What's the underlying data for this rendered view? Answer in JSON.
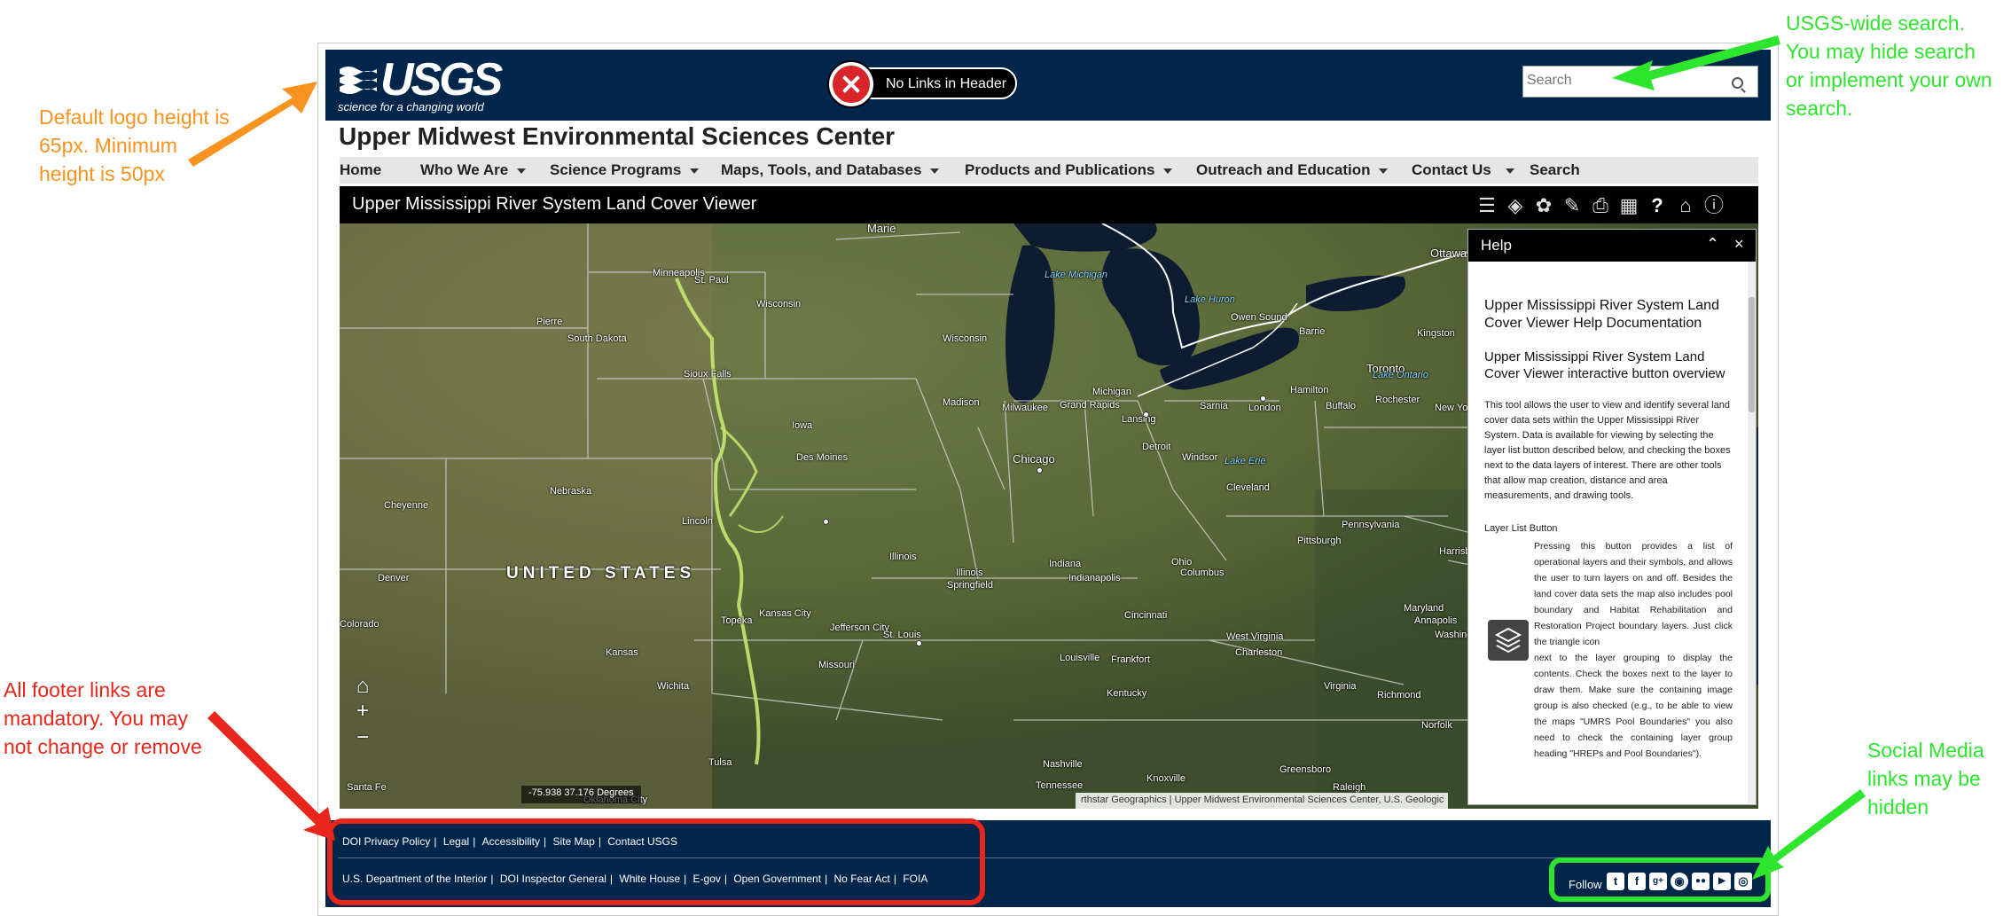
{
  "annotations": {
    "logo_note": [
      "Default logo height is",
      "65px. Minimum",
      "height is 50px"
    ],
    "search_note": [
      "USGS-wide search.",
      "You may hide search",
      "or implement your own",
      "search."
    ],
    "footer_note": [
      "All footer links are",
      "mandatory. You may",
      "not change or remove"
    ],
    "social_note": [
      "Social Media",
      "links may be",
      "hidden"
    ]
  },
  "header": {
    "logo_word": "USGS",
    "logo_tagline": "science for a changing world",
    "no_links_label": "No Links in Header",
    "search_placeholder": "Search"
  },
  "site_title": "Upper Midwest Environmental Sciences Center",
  "nav": [
    {
      "label": "Home",
      "dropdown": false
    },
    {
      "label": "Who We Are",
      "dropdown": true
    },
    {
      "label": "Science Programs",
      "dropdown": true
    },
    {
      "label": "Maps, Tools, and Databases",
      "dropdown": true
    },
    {
      "label": "Products and Publications",
      "dropdown": true
    },
    {
      "label": "Outreach and Education",
      "dropdown": true
    },
    {
      "label": "Contact Us",
      "dropdown": true
    },
    {
      "label": "Search",
      "dropdown": false
    }
  ],
  "app": {
    "title": "Upper Mississippi River System Land Cover Viewer",
    "tools": [
      "layer-list-icon",
      "layers-icon",
      "palette-icon",
      "ruler-icon",
      "print-icon",
      "basemap-grid-icon",
      "help-icon",
      "education-icon",
      "info-icon"
    ]
  },
  "map": {
    "coords": "-75.938 37.176 Degrees",
    "attribution": "rthstar Geographics | Upper Midwest Environmental Sciences Center, U.S. Geologic",
    "country_label": "UNITED STATES",
    "lakes": [
      "Lake Michigan",
      "Lake Huron",
      "Lake Ontario",
      "Lake Erie"
    ],
    "places": [
      "Marie",
      "Ottawa",
      "Minneapolis",
      "St. Paul",
      "Wisconsin",
      "Pierre",
      "South Dakota",
      "Wisconsin",
      "Owen Sound",
      "Barrie",
      "Kingston",
      "Toronto",
      "Sioux Falls",
      "Madison",
      "Milwaukee",
      "Michigan",
      "Grand Rapids",
      "Lansing",
      "Sarnia",
      "London",
      "Hamilton",
      "Buffalo",
      "Rochester",
      "New Yo",
      "Iowa",
      "Des Moines",
      "Chicago",
      "Detroit",
      "Windsor",
      "Cleveland",
      "Nebraska",
      "Cheyenne",
      "Lincoln",
      "Illinois",
      "Illinois",
      "Springfield",
      "Indiana",
      "Indianapolis",
      "Ohio",
      "Columbus",
      "Pittsburgh",
      "Pennsylvania",
      "Harrisburg",
      "Denver",
      "Topeka",
      "Kansas City",
      "Jefferson City",
      "St. Louis",
      "Cincinnati",
      "Colorado",
      "Kansas",
      "Missouri",
      "West Virginia",
      "Charleston",
      "Maryland",
      "Annapolis",
      "Washington",
      "Wichita",
      "Louisville",
      "Frankfort",
      "Kentucky",
      "Virginia",
      "Richmond",
      "Tulsa",
      "Nashville",
      "Knoxville",
      "Greensboro",
      "Raleigh",
      "Norfolk",
      "Santa Fe",
      "Oklahoma City",
      "Tennessee"
    ]
  },
  "help": {
    "title": "Help",
    "heading1": "Upper Mississippi River System Land Cover Viewer Help Documentation",
    "heading2": "Upper Mississippi River System Land Cover Viewer interactive button overview",
    "intro": "This tool allows the user to view and identify several land cover data sets within the Upper Mississippi River System.  Data is available for viewing by selecting the layer list button described below, and checking the boxes next to the data layers of interest.   There are other tools that allow map creation, distance and area measurements, and drawing tools.",
    "section_title": "Layer List Button",
    "section_text_a": "Pressing this button provides a list of operational layers and their symbols, and allows the user to turn layers on and off.  Besides the land cover data sets the map also includes pool boundary and Habitat Rehabilitation and Restoration Project boundary layers.  Just click the triangle icon",
    "section_text_b": "next to the layer grouping to display the contents.  Check the boxes next to the layer to draw them.   Make sure the containing image group is also checked (e.g., to be able to view the maps \"UMRS Pool Boundaries\" you also need to check the containing layer group heading \"HREPs and Pool Boundaries\")."
  },
  "footer": {
    "row1": [
      "DOI Privacy Policy",
      "Legal",
      "Accessibility",
      "Site Map",
      "Contact USGS"
    ],
    "row2": [
      "U.S. Department of the Interior",
      "DOI Inspector General",
      "White House",
      "E-gov",
      "Open Government",
      "No Fear Act",
      "FOIA"
    ],
    "follow_label": "Follow",
    "social": [
      "twitter-icon",
      "facebook-icon",
      "google-plus-icon",
      "github-icon",
      "flickr-icon",
      "youtube-icon",
      "instagram-icon"
    ]
  },
  "colors": {
    "usgs_navy": "#00264c",
    "note_orange": "#f7931e",
    "note_red": "#e8261b",
    "note_green": "#2ee52e"
  }
}
